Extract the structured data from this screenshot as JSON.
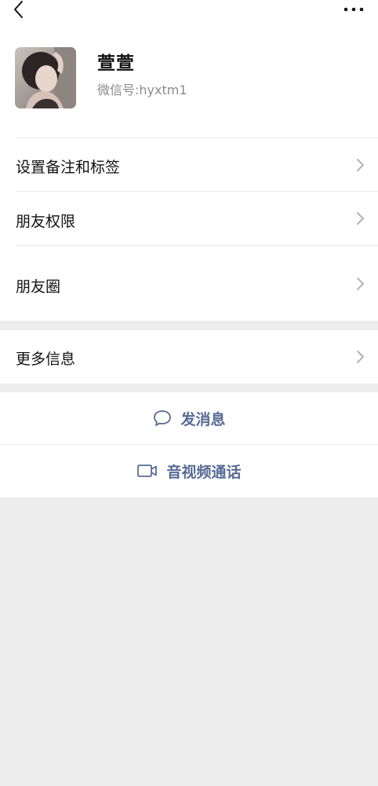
{
  "contact": {
    "name": "萱萱",
    "wechat_id_label": "微信号:",
    "wechat_id_value": "hyxtm1"
  },
  "menu": {
    "set_remark": "设置备注和标签",
    "friend_permissions": "朋友权限",
    "moments": "朋友圈",
    "more_info": "更多信息"
  },
  "actions": {
    "send_message": "发消息",
    "video_call": "音视频通话"
  },
  "icons": {
    "back": "chevron-left-icon",
    "more": "more-dots-icon",
    "row_arrow": "chevron-right-icon",
    "message": "speech-bubble-icon",
    "video": "video-camera-icon"
  },
  "colors": {
    "link_blue": "#576b95",
    "background_gray": "#ededed",
    "secondary_text": "#8a8a8a"
  }
}
